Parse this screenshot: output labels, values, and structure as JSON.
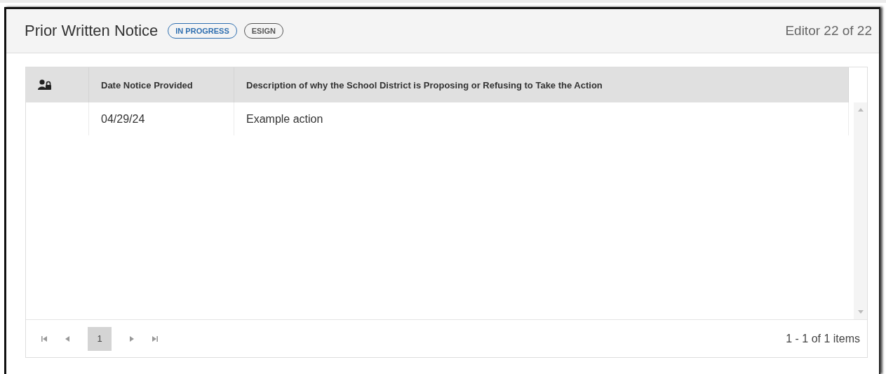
{
  "panel": {
    "title": "Prior Written Notice",
    "badges": [
      {
        "label": "IN PROGRESS",
        "color": "#2f6fb0"
      },
      {
        "label": "ESIGN",
        "color": "#555555"
      }
    ],
    "editor_count": "Editor 22 of 22"
  },
  "table": {
    "columns": [
      {
        "kind": "icon"
      },
      {
        "kind": "text",
        "label": "Date Notice Provided"
      },
      {
        "kind": "text",
        "label": "Description of why the School District is Proposing or Refusing to Take the Action"
      }
    ],
    "rows": [
      {
        "cells": [
          "",
          "04/29/24",
          "Example action"
        ]
      }
    ]
  },
  "pager": {
    "pages": [
      {
        "label": "1",
        "selected": true
      }
    ],
    "summary": "1 - 1 of 1 items"
  }
}
